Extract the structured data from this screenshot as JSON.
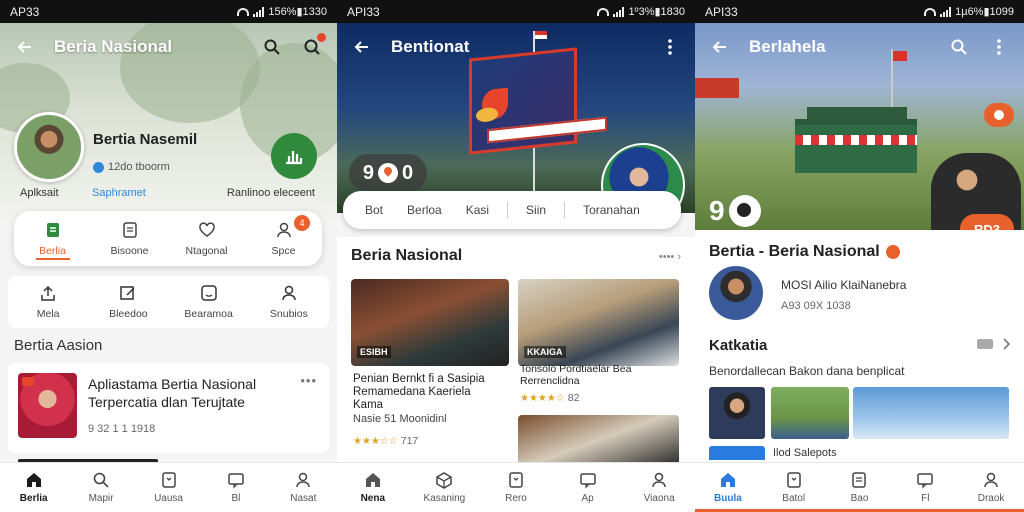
{
  "screens": [
    {
      "status": {
        "carrier": "AP33",
        "right": "156%▮1330"
      },
      "appbar": {
        "title": "Beria Nasional"
      },
      "profile": {
        "name": "Bertia Nasemil",
        "subtitle": "12do tboorm",
        "left_caption": "Aplksait",
        "blue_caption": "Saphramet",
        "right_caption": "Ranlinoo eleceent"
      },
      "tabs": [
        {
          "label": "Berlia",
          "icon": "document-icon"
        },
        {
          "label": "Bisoone",
          "icon": "list-icon"
        },
        {
          "label": "Ntagonal",
          "icon": "heart-icon"
        },
        {
          "label": "Spce",
          "icon": "user-icon",
          "badge": "4"
        }
      ],
      "quick": [
        {
          "label": "Mela",
          "icon": "upload-icon"
        },
        {
          "label": "Bleedoo",
          "icon": "edit-icon"
        },
        {
          "label": "Bearamoa",
          "icon": "smile-icon"
        },
        {
          "label": "Snubios",
          "icon": "person-icon"
        }
      ],
      "section_title": "Bertia Aasion",
      "card": {
        "line1": "Apliastama Bertia Nasional",
        "line2": "Terpercatia dlan Terujtate",
        "meta": "9 32 1 1 1918"
      },
      "bottom_nav": [
        {
          "label": "Berlia",
          "icon": "home-icon"
        },
        {
          "label": "Mapir",
          "icon": "search-icon"
        },
        {
          "label": "Uausa",
          "icon": "bookmark-icon"
        },
        {
          "label": "Bl",
          "icon": "message-icon"
        },
        {
          "label": "Nasat",
          "icon": "user-icon"
        }
      ]
    },
    {
      "status": {
        "carrier": "API33",
        "right": "1º3%▮1830"
      },
      "appbar": {
        "title": "Bentionat"
      },
      "play_chip": "9",
      "play_chip_tail": "0",
      "categories": [
        "Bot",
        "Berloa",
        "Kasi",
        "Siin",
        "Toranahan"
      ],
      "heading": "Beria Nasional",
      "heading_more": "•••• ›",
      "news": [
        {
          "label": "ESIBH",
          "caption": "Penian Bernkt fi a Sasipia Remamedana Kaeriela Kama",
          "meta": "Nasie 51 Moonidinl",
          "stars": "★★★☆☆",
          "rating": "717"
        },
        {
          "label": "KKAIGA",
          "caption": "Tonsolo Pordtiaelar Bea Rerrenclidna",
          "stars": "★★★★☆",
          "rating": "82"
        }
      ],
      "bottom_nav": [
        {
          "label": "Nena",
          "icon": "home-icon"
        },
        {
          "label": "Kasaning",
          "icon": "box-icon"
        },
        {
          "label": "Rero",
          "icon": "bookmark-icon"
        },
        {
          "label": "Ap",
          "icon": "message-icon"
        },
        {
          "label": "Viaona",
          "icon": "user-icon"
        }
      ]
    },
    {
      "status": {
        "carrier": "API33",
        "right": "1µ6%▮1099"
      },
      "appbar": {
        "title": "Berlahela"
      },
      "score": "9",
      "orange_pill": "RD3",
      "title": "Bertia - Beria Nasional",
      "channel_name": "MOSI Ailio KlaiNanebra",
      "channel_meta": "A93 09X 1038",
      "section": "Katkatia",
      "description": "Benordallecan Bakon dana benplicat",
      "peek": "Ilod Salepots",
      "bottom_nav": [
        {
          "label": "Buula",
          "icon": "home-icon"
        },
        {
          "label": "Batol",
          "icon": "bookmark-icon"
        },
        {
          "label": "Bao",
          "icon": "document-icon"
        },
        {
          "label": "Fl",
          "icon": "message-icon"
        },
        {
          "label": "Draok",
          "icon": "user-icon"
        }
      ]
    }
  ],
  "colors": {
    "accent": "#e8612c",
    "green": "#2f8a3c",
    "blue": "#2a7be0"
  }
}
